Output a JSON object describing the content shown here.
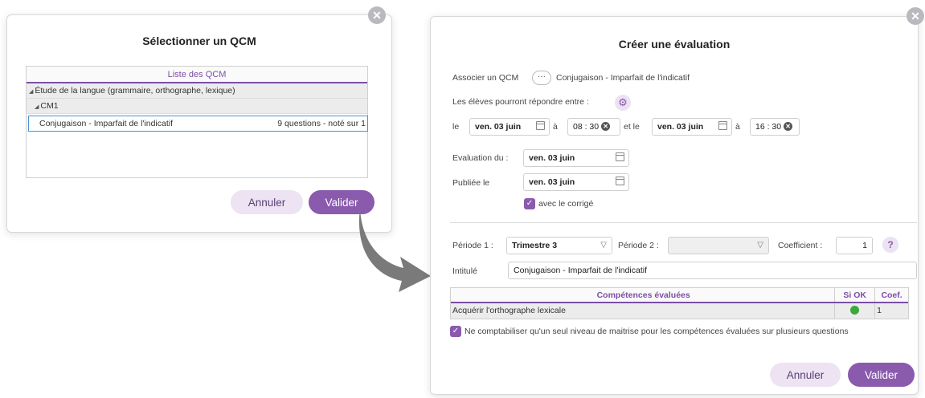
{
  "select_dialog": {
    "title": "Sélectionner un QCM",
    "list_header": "Liste des QCM",
    "category": "Étude de la langue (grammaire, orthographe, lexique)",
    "level": "CM1",
    "qcm_name": "Conjugaison - Imparfait de l'indicatif",
    "qcm_info": "9 questions - noté sur 1",
    "cancel_label": "Annuler",
    "validate_label": "Valider"
  },
  "eval_dialog": {
    "title": "Créer une évaluation",
    "associate_label": "Associer un QCM",
    "associate_btn": "···",
    "associated_qcm": "Conjugaison - Imparfait de l'indicatif",
    "students_label": "Les élèves pourront répondre entre :",
    "le_label": "le",
    "date_start": "ven. 03 juin",
    "a_label_1": "à",
    "time_start": "08 : 30",
    "et_le_label": "et le",
    "date_end": "ven. 03 juin",
    "a_label_2": "à",
    "time_end": "16 : 30",
    "eval_date_label": "Evaluation du :",
    "eval_date": "ven. 03 juin",
    "published_label": "Publiée le",
    "published_date": "ven. 03 juin",
    "with_correction": "avec le corrigé",
    "periode1_label": "Période 1 :",
    "periode1_value": "Trimestre 3",
    "periode2_label": "Période 2 :",
    "periode2_value": "",
    "coef_label": "Coefficient :",
    "coef_value": "1",
    "help_label": "?",
    "intitule_label": "Intitulé",
    "intitule_value": "Conjugaison - Imparfait de l'indicatif",
    "table": {
      "col_competences": "Compétences évaluées",
      "col_si_ok": "Si OK",
      "col_coef": "Coef.",
      "rows": [
        {
          "competence": "Acquérir l'orthographe lexicale",
          "coef": "1",
          "status_color": "#3aa83a"
        }
      ]
    },
    "single_level_label": "Ne comptabiliser qu'un seul niveau de maitrise pour les compétences évaluées sur plusieurs questions",
    "cancel_label": "Annuler",
    "validate_label": "Valider"
  },
  "colors": {
    "accent": "#8a5aad",
    "accent_light": "#ede3f3",
    "header_purple": "#7b4fa6",
    "arrow_gray": "#7a7a7a"
  },
  "icons": {
    "close": "close-icon",
    "calendar": "calendar-icon",
    "gear": "gear-icon",
    "clear": "clear-icon",
    "chevron": "chevron-down-icon",
    "arrow": "curved-arrow-icon"
  }
}
